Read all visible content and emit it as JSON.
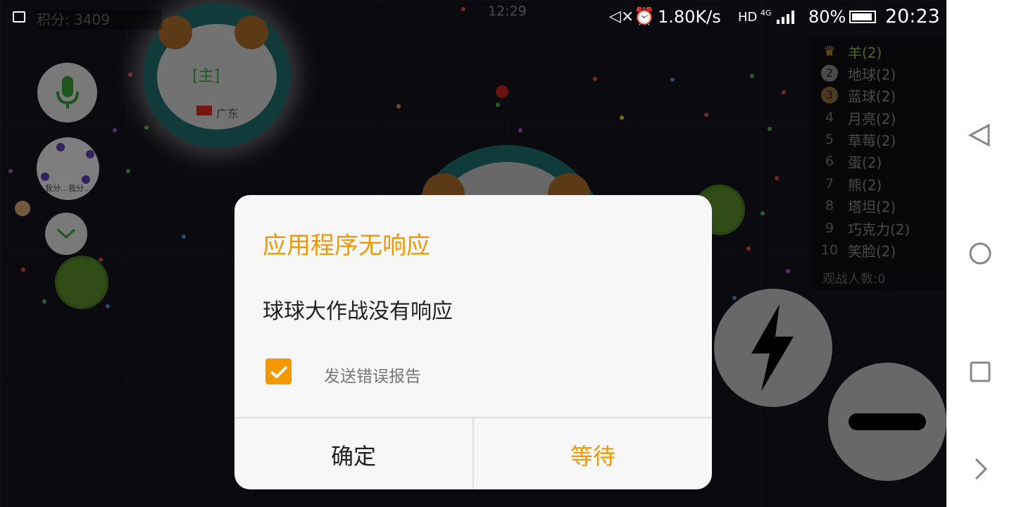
{
  "status_bar": {
    "game_time": "12:29",
    "network_speed": "1.80K/s",
    "hd_badge": "HD",
    "network_type": "4G",
    "battery": "80%",
    "clock": "20:23",
    "icons": [
      "image-icon",
      "mute-icon",
      "alarm-icon",
      "signal-icon",
      "battery-icon"
    ]
  },
  "game": {
    "score_label": "积分: 3409",
    "player_tag": "[主]",
    "player_region": "广东",
    "minimap_text": "我分…我分…",
    "leaderboard": [
      {
        "rank": "1",
        "name": "羊(2)",
        "icon": "crown-icon",
        "color": "#8fbf3a"
      },
      {
        "rank": "2",
        "name": "地球(2)",
        "icon": "medal-silver-icon",
        "color": "#888888"
      },
      {
        "rank": "3",
        "name": "蓝球(2)",
        "icon": "medal-bronze-icon",
        "color": "#888888"
      },
      {
        "rank": "4",
        "name": "月亮(2)"
      },
      {
        "rank": "5",
        "name": "草莓(2)"
      },
      {
        "rank": "6",
        "name": "蛋(2)"
      },
      {
        "rank": "7",
        "name": "熊(2)"
      },
      {
        "rank": "8",
        "name": "塔坦(2)"
      },
      {
        "rank": "9",
        "name": "巧克力(2)"
      },
      {
        "rank": "10",
        "name": "笑脸(2)"
      }
    ],
    "spectators": "观战人数:0",
    "controls": [
      "microphone-icon",
      "expand-icon",
      "split-icon",
      "eject-icon"
    ]
  },
  "dialog": {
    "title": "应用程序无响应",
    "message": "球球大作战没有响应",
    "checkbox_label": "发送错误报告",
    "checkbox_checked": true,
    "ok_label": "确定",
    "wait_label": "等待",
    "accent_color": "#f39800"
  },
  "nav_bar": {
    "buttons": [
      "back-icon",
      "home-icon",
      "recents-icon",
      "hide-nav-icon"
    ]
  }
}
